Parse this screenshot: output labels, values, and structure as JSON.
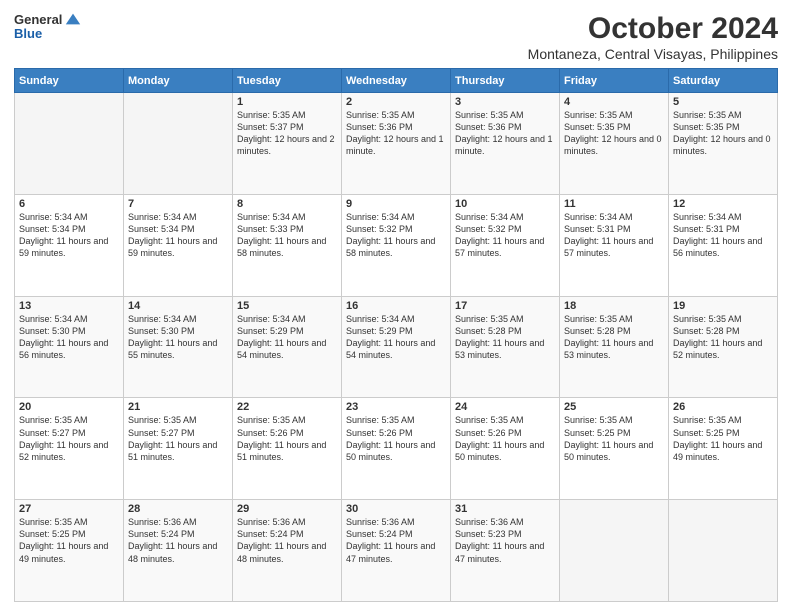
{
  "logo": {
    "line1": "General",
    "line2": "Blue"
  },
  "header": {
    "title": "October 2024",
    "subtitle": "Montaneza, Central Visayas, Philippines"
  },
  "weekdays": [
    "Sunday",
    "Monday",
    "Tuesday",
    "Wednesday",
    "Thursday",
    "Friday",
    "Saturday"
  ],
  "weeks": [
    [
      {
        "day": "",
        "sunrise": "",
        "sunset": "",
        "daylight": ""
      },
      {
        "day": "",
        "sunrise": "",
        "sunset": "",
        "daylight": ""
      },
      {
        "day": "1",
        "sunrise": "Sunrise: 5:35 AM",
        "sunset": "Sunset: 5:37 PM",
        "daylight": "Daylight: 12 hours and 2 minutes."
      },
      {
        "day": "2",
        "sunrise": "Sunrise: 5:35 AM",
        "sunset": "Sunset: 5:36 PM",
        "daylight": "Daylight: 12 hours and 1 minute."
      },
      {
        "day": "3",
        "sunrise": "Sunrise: 5:35 AM",
        "sunset": "Sunset: 5:36 PM",
        "daylight": "Daylight: 12 hours and 1 minute."
      },
      {
        "day": "4",
        "sunrise": "Sunrise: 5:35 AM",
        "sunset": "Sunset: 5:35 PM",
        "daylight": "Daylight: 12 hours and 0 minutes."
      },
      {
        "day": "5",
        "sunrise": "Sunrise: 5:35 AM",
        "sunset": "Sunset: 5:35 PM",
        "daylight": "Daylight: 12 hours and 0 minutes."
      }
    ],
    [
      {
        "day": "6",
        "sunrise": "Sunrise: 5:34 AM",
        "sunset": "Sunset: 5:34 PM",
        "daylight": "Daylight: 11 hours and 59 minutes."
      },
      {
        "day": "7",
        "sunrise": "Sunrise: 5:34 AM",
        "sunset": "Sunset: 5:34 PM",
        "daylight": "Daylight: 11 hours and 59 minutes."
      },
      {
        "day": "8",
        "sunrise": "Sunrise: 5:34 AM",
        "sunset": "Sunset: 5:33 PM",
        "daylight": "Daylight: 11 hours and 58 minutes."
      },
      {
        "day": "9",
        "sunrise": "Sunrise: 5:34 AM",
        "sunset": "Sunset: 5:32 PM",
        "daylight": "Daylight: 11 hours and 58 minutes."
      },
      {
        "day": "10",
        "sunrise": "Sunrise: 5:34 AM",
        "sunset": "Sunset: 5:32 PM",
        "daylight": "Daylight: 11 hours and 57 minutes."
      },
      {
        "day": "11",
        "sunrise": "Sunrise: 5:34 AM",
        "sunset": "Sunset: 5:31 PM",
        "daylight": "Daylight: 11 hours and 57 minutes."
      },
      {
        "day": "12",
        "sunrise": "Sunrise: 5:34 AM",
        "sunset": "Sunset: 5:31 PM",
        "daylight": "Daylight: 11 hours and 56 minutes."
      }
    ],
    [
      {
        "day": "13",
        "sunrise": "Sunrise: 5:34 AM",
        "sunset": "Sunset: 5:30 PM",
        "daylight": "Daylight: 11 hours and 56 minutes."
      },
      {
        "day": "14",
        "sunrise": "Sunrise: 5:34 AM",
        "sunset": "Sunset: 5:30 PM",
        "daylight": "Daylight: 11 hours and 55 minutes."
      },
      {
        "day": "15",
        "sunrise": "Sunrise: 5:34 AM",
        "sunset": "Sunset: 5:29 PM",
        "daylight": "Daylight: 11 hours and 54 minutes."
      },
      {
        "day": "16",
        "sunrise": "Sunrise: 5:34 AM",
        "sunset": "Sunset: 5:29 PM",
        "daylight": "Daylight: 11 hours and 54 minutes."
      },
      {
        "day": "17",
        "sunrise": "Sunrise: 5:35 AM",
        "sunset": "Sunset: 5:28 PM",
        "daylight": "Daylight: 11 hours and 53 minutes."
      },
      {
        "day": "18",
        "sunrise": "Sunrise: 5:35 AM",
        "sunset": "Sunset: 5:28 PM",
        "daylight": "Daylight: 11 hours and 53 minutes."
      },
      {
        "day": "19",
        "sunrise": "Sunrise: 5:35 AM",
        "sunset": "Sunset: 5:28 PM",
        "daylight": "Daylight: 11 hours and 52 minutes."
      }
    ],
    [
      {
        "day": "20",
        "sunrise": "Sunrise: 5:35 AM",
        "sunset": "Sunset: 5:27 PM",
        "daylight": "Daylight: 11 hours and 52 minutes."
      },
      {
        "day": "21",
        "sunrise": "Sunrise: 5:35 AM",
        "sunset": "Sunset: 5:27 PM",
        "daylight": "Daylight: 11 hours and 51 minutes."
      },
      {
        "day": "22",
        "sunrise": "Sunrise: 5:35 AM",
        "sunset": "Sunset: 5:26 PM",
        "daylight": "Daylight: 11 hours and 51 minutes."
      },
      {
        "day": "23",
        "sunrise": "Sunrise: 5:35 AM",
        "sunset": "Sunset: 5:26 PM",
        "daylight": "Daylight: 11 hours and 50 minutes."
      },
      {
        "day": "24",
        "sunrise": "Sunrise: 5:35 AM",
        "sunset": "Sunset: 5:26 PM",
        "daylight": "Daylight: 11 hours and 50 minutes."
      },
      {
        "day": "25",
        "sunrise": "Sunrise: 5:35 AM",
        "sunset": "Sunset: 5:25 PM",
        "daylight": "Daylight: 11 hours and 50 minutes."
      },
      {
        "day": "26",
        "sunrise": "Sunrise: 5:35 AM",
        "sunset": "Sunset: 5:25 PM",
        "daylight": "Daylight: 11 hours and 49 minutes."
      }
    ],
    [
      {
        "day": "27",
        "sunrise": "Sunrise: 5:35 AM",
        "sunset": "Sunset: 5:25 PM",
        "daylight": "Daylight: 11 hours and 49 minutes."
      },
      {
        "day": "28",
        "sunrise": "Sunrise: 5:36 AM",
        "sunset": "Sunset: 5:24 PM",
        "daylight": "Daylight: 11 hours and 48 minutes."
      },
      {
        "day": "29",
        "sunrise": "Sunrise: 5:36 AM",
        "sunset": "Sunset: 5:24 PM",
        "daylight": "Daylight: 11 hours and 48 minutes."
      },
      {
        "day": "30",
        "sunrise": "Sunrise: 5:36 AM",
        "sunset": "Sunset: 5:24 PM",
        "daylight": "Daylight: 11 hours and 47 minutes."
      },
      {
        "day": "31",
        "sunrise": "Sunrise: 5:36 AM",
        "sunset": "Sunset: 5:23 PM",
        "daylight": "Daylight: 11 hours and 47 minutes."
      },
      {
        "day": "",
        "sunrise": "",
        "sunset": "",
        "daylight": ""
      },
      {
        "day": "",
        "sunrise": "",
        "sunset": "",
        "daylight": ""
      }
    ]
  ]
}
